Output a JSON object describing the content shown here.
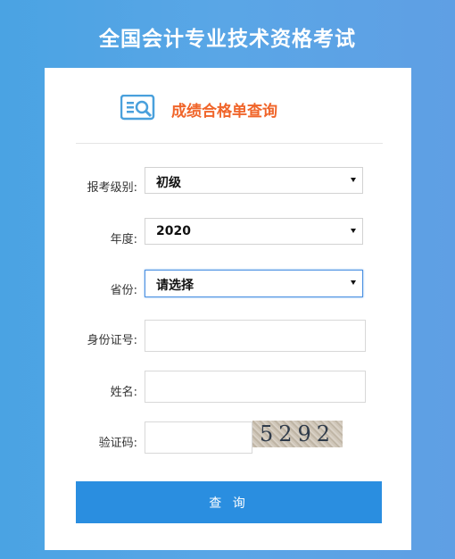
{
  "page": {
    "title": "全国会计专业技术资格考试"
  },
  "header": {
    "title": "成绩合格单查询",
    "icon": "search-document-icon"
  },
  "form": {
    "level": {
      "label": "报考级别:",
      "value": "初级"
    },
    "year": {
      "label": "年度:",
      "value": "2020"
    },
    "province": {
      "label": "省份:",
      "value": "请选择"
    },
    "id_number": {
      "label": "身份证号:",
      "value": ""
    },
    "name": {
      "label": "姓名:",
      "value": ""
    },
    "captcha": {
      "label": "验证码:",
      "value": "",
      "image_text": "5292"
    },
    "submit_label": "查 询"
  },
  "colors": {
    "accent": "#2a8ee0",
    "title": "#f0652a",
    "background": "#5aa6e6"
  }
}
